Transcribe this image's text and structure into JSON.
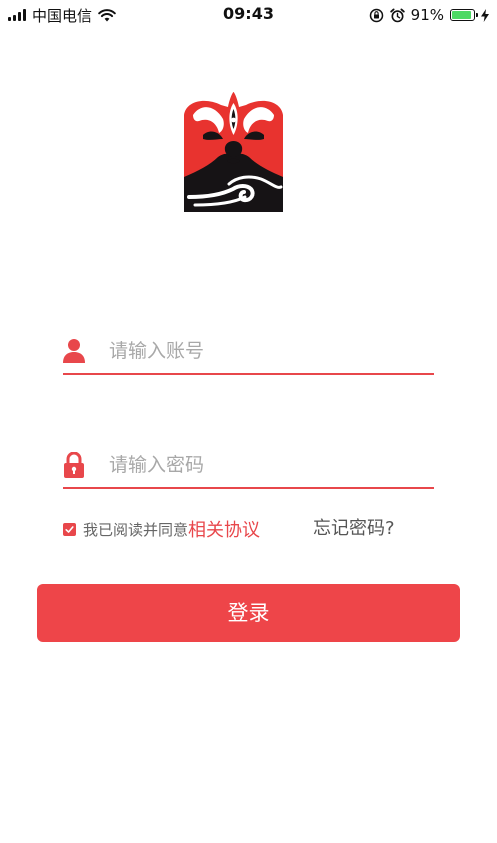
{
  "status_bar": {
    "carrier": "中国电信",
    "time": "09:43",
    "battery_percent": "91%",
    "battery_level": 0.91,
    "icons": [
      "signal-icon",
      "wifi-icon",
      "orientation-lock-icon",
      "alarm-icon",
      "battery-icon",
      "charging-icon"
    ]
  },
  "logo": {
    "icon": "opera-mask-logo"
  },
  "login_form": {
    "account_placeholder": "请输入账号",
    "account_value": "",
    "account_icon": "user-icon",
    "password_placeholder": "请输入密码",
    "password_value": "",
    "password_icon": "lock-icon",
    "agreement_checked": true,
    "agreement_text": "我已阅读并同意",
    "agreement_link": "相关协议",
    "forgot_password": "忘记密码?",
    "login_button": "登录"
  },
  "colors": {
    "accent": "#ee4549",
    "underline": "#e8474b",
    "placeholder": "#a8a8a8",
    "battery": "#4cd964"
  }
}
